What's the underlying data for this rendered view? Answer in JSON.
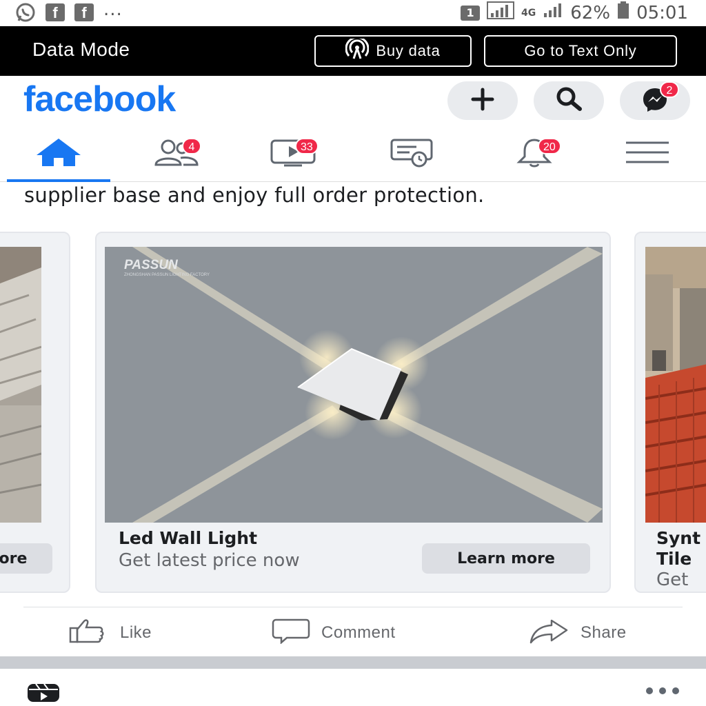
{
  "status_bar": {
    "icons": [
      "whatsapp-icon",
      "facebook-icon",
      "facebook-icon"
    ],
    "overflow": "...",
    "sim": "1",
    "network": "4G",
    "battery": "62%",
    "time": "05:01"
  },
  "data_bar": {
    "label": "Data Mode",
    "buy_label": "Buy data",
    "text_only_label": "Go to Text Only"
  },
  "header": {
    "logo": "facebook",
    "messenger_badge": "2"
  },
  "nav": {
    "friends_badge": "4",
    "watch_badge": "33",
    "notifications_badge": "20"
  },
  "post": {
    "text": "supplier base and enjoy full order protection."
  },
  "carousel": {
    "left_button_partial": "ore",
    "center": {
      "brand": "PASSUN",
      "brand_sub": "ZHONGSHAN PASSUN LIGHTING FACTORY",
      "title": "Led Wall Light",
      "subtitle": "Get latest price now",
      "button": "Learn more"
    },
    "right": {
      "title_line1": "Synt",
      "title_line2": "Tile",
      "subtitle": "Get"
    }
  },
  "actions": {
    "like": "Like",
    "comment": "Comment",
    "share": "Share"
  },
  "colors": {
    "brand": "#1877f2",
    "badge": "#f02849",
    "bar": "#000000"
  }
}
